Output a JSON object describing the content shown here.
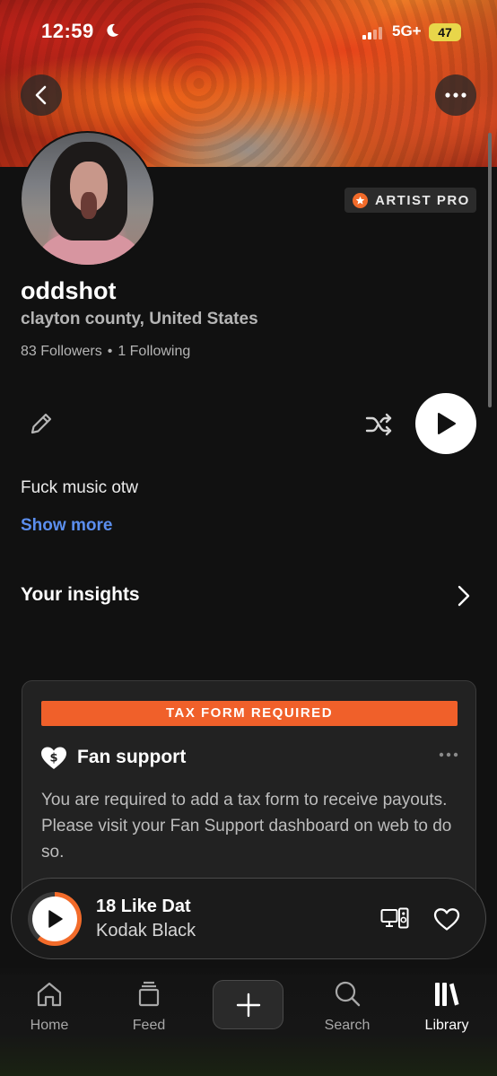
{
  "status_bar": {
    "time": "12:59",
    "network": "5G+",
    "battery": "47",
    "icons": [
      "moon-icon",
      "signal-icon"
    ]
  },
  "header": {
    "back_icon": "chevron-left-icon",
    "more_icon": "more-horizontal-icon"
  },
  "profile": {
    "badge": "ARTIST PRO",
    "name": "oddshot",
    "location": "clayton county, United States",
    "followers": "83 Followers",
    "separator": "•",
    "following": "1 Following",
    "bio": "Fuck music otw",
    "show_more": "Show more"
  },
  "actions": {
    "edit_icon": "pencil-icon",
    "shuffle_icon": "shuffle-icon",
    "play_icon": "play-icon"
  },
  "insights": {
    "title": "Your insights",
    "icon": "chevron-right-icon"
  },
  "fan_support_card": {
    "banner": "TAX FORM REQUIRED",
    "title": "Fan support",
    "description": "You are required to add a tax form to receive payouts. Please visit your Fan Support dashboard on web to do so.",
    "icon": "heart-dollar-icon",
    "menu_icon": "more-horizontal-icon"
  },
  "mini_player": {
    "track": "18 Like Dat",
    "artist": "Kodak Black",
    "progress": 0.61,
    "accent": "#f26b2a"
  },
  "tabbar": {
    "tabs": [
      {
        "label": "Home",
        "icon": "home-icon",
        "active": false
      },
      {
        "label": "Feed",
        "icon": "feed-icon",
        "active": false
      },
      {
        "label": "Search",
        "icon": "search-icon",
        "active": false
      },
      {
        "label": "Library",
        "icon": "library-icon",
        "active": true
      }
    ],
    "create_icon": "plus-icon"
  },
  "colors": {
    "background": "#111111",
    "accent": "#f26b2a",
    "link": "#5b8eee",
    "tax_banner": "#f0602a"
  }
}
